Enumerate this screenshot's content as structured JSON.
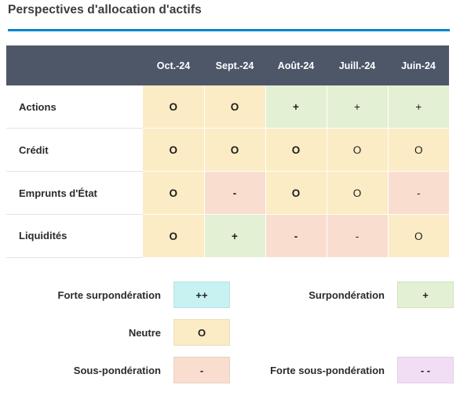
{
  "header": {
    "title": "Perspectives d'allocation d'actifs",
    "accent_color": "#0086c9"
  },
  "table": {
    "corner_label": "",
    "header_background": "#4e5768",
    "columns": [
      "Oct.-24",
      "Sept.-24",
      "Août-24",
      "Juill.-24",
      "Juin-24"
    ],
    "rows": [
      {
        "label": "Actions",
        "cells": [
          {
            "value": "O",
            "color": "#fbecc5",
            "weight": "strong"
          },
          {
            "value": "O",
            "color": "#fbecc5",
            "weight": "strong"
          },
          {
            "value": "+",
            "color": "#e3f0d3",
            "weight": "strong"
          },
          {
            "value": "+",
            "color": "#e3f0d3",
            "weight": "light"
          },
          {
            "value": "+",
            "color": "#e3f0d3",
            "weight": "light"
          }
        ]
      },
      {
        "label": "Crédit",
        "cells": [
          {
            "value": "O",
            "color": "#fbecc5",
            "weight": "strong"
          },
          {
            "value": "O",
            "color": "#fbecc5",
            "weight": "strong"
          },
          {
            "value": "O",
            "color": "#fbecc5",
            "weight": "strong"
          },
          {
            "value": "O",
            "color": "#fbecc5",
            "weight": "light"
          },
          {
            "value": "O",
            "color": "#fbecc5",
            "weight": "light"
          }
        ]
      },
      {
        "label": "Emprunts d'État",
        "cells": [
          {
            "value": "O",
            "color": "#fbecc5",
            "weight": "strong"
          },
          {
            "value": "-",
            "color": "#f9ded0",
            "weight": "strong"
          },
          {
            "value": "O",
            "color": "#fbecc5",
            "weight": "strong"
          },
          {
            "value": "O",
            "color": "#fbecc5",
            "weight": "light"
          },
          {
            "value": "-",
            "color": "#f9ded0",
            "weight": "light"
          }
        ]
      },
      {
        "label": "Liquidités",
        "cells": [
          {
            "value": "O",
            "color": "#fbecc5",
            "weight": "strong"
          },
          {
            "value": "+",
            "color": "#e3f0d3",
            "weight": "strong"
          },
          {
            "value": "-",
            "color": "#f9ded0",
            "weight": "strong"
          },
          {
            "value": "-",
            "color": "#f9ded0",
            "weight": "light"
          },
          {
            "value": "O",
            "color": "#fbecc5",
            "weight": "light"
          }
        ]
      }
    ]
  },
  "legend": {
    "rows": [
      {
        "left": {
          "label": "Forte surpondération",
          "symbol": "++",
          "color": "#c8f1f1"
        },
        "right": {
          "label": "Surpondération",
          "symbol": "+",
          "color": "#e3f0d3"
        }
      },
      {
        "left": {
          "label": "Neutre",
          "symbol": "O",
          "color": "#fbecc5"
        },
        "right": null
      },
      {
        "left": {
          "label": "Sous-pondération",
          "symbol": "-",
          "color": "#f9ded0"
        },
        "right": {
          "label": "Forte sous-pondération",
          "symbol": "- -",
          "color": "#f1ddf4"
        }
      }
    ]
  }
}
